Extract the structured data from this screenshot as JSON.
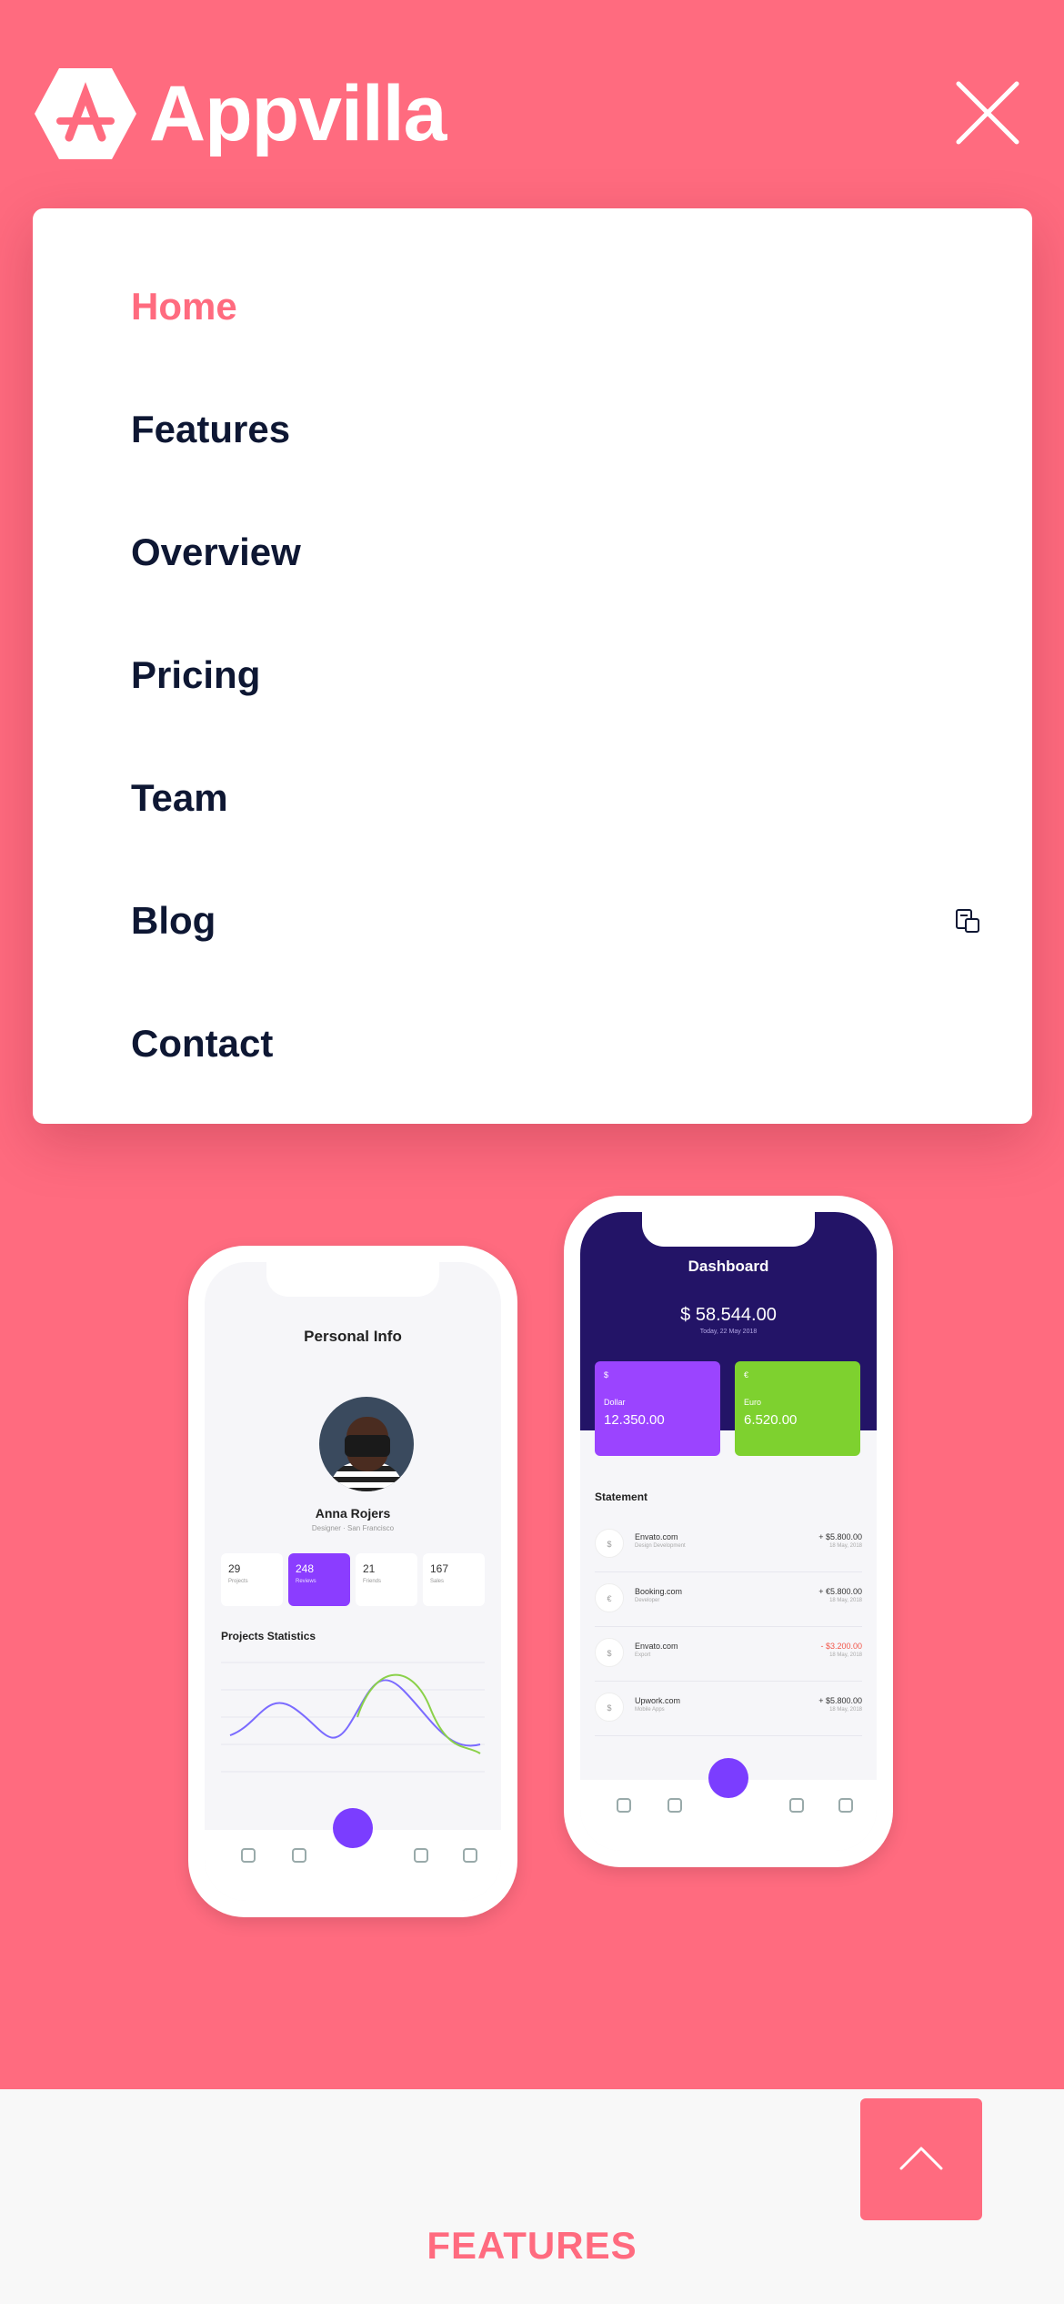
{
  "brand": {
    "name": "Appvilla",
    "logo_icon": "app-store-hex-icon"
  },
  "colors": {
    "accent": "#FF6B7F",
    "text_dark": "#0E1733",
    "band": "#F8F8F8"
  },
  "menu": {
    "items": [
      {
        "label": "Home",
        "active": true
      },
      {
        "label": "Features"
      },
      {
        "label": "Overview"
      },
      {
        "label": "Pricing"
      },
      {
        "label": "Team"
      },
      {
        "label": "Blog"
      },
      {
        "label": "Contact"
      }
    ]
  },
  "close_icon": "close-icon",
  "phone_left": {
    "title": "Personal Info",
    "name": "Anna Rojers",
    "role": "Designer   ·   San Francisco",
    "stats": [
      {
        "value": "29",
        "label": "Projects"
      },
      {
        "value": "248",
        "label": "Reviews"
      },
      {
        "value": "21",
        "label": "Friends"
      },
      {
        "value": "167",
        "label": "Sales"
      }
    ],
    "section": "Projects Statistics"
  },
  "phone_right": {
    "title": "Dashboard",
    "balance": "$ 58.544.00",
    "balance_sub": "Today, 22 May 2018",
    "cards": [
      {
        "symbol": "$",
        "currency": "Dollar",
        "amount": "12.350.00"
      },
      {
        "symbol": "€",
        "currency": "Euro",
        "amount": "6.520.00"
      }
    ],
    "statement_title": "Statement",
    "statement": [
      {
        "icon": "$",
        "name": "Envato.com",
        "sub": "Design Development",
        "value": "+ $5.800.00",
        "date": "18 May, 2018"
      },
      {
        "icon": "€",
        "name": "Booking.com",
        "sub": "Developer",
        "value": "+ €5.800.00",
        "date": "18 May, 2018"
      },
      {
        "icon": "$",
        "name": "Envato.com",
        "sub": "Export",
        "value": "- $3.200.00",
        "date": "18 May, 2018",
        "negative": true
      },
      {
        "icon": "$",
        "name": "Upwork.com",
        "sub": "Mobile Apps",
        "value": "+ $5.800.00",
        "date": "18 May, 2018"
      }
    ]
  },
  "features_label": "FEATURES",
  "scroll_top_icon": "chevron-up-icon"
}
